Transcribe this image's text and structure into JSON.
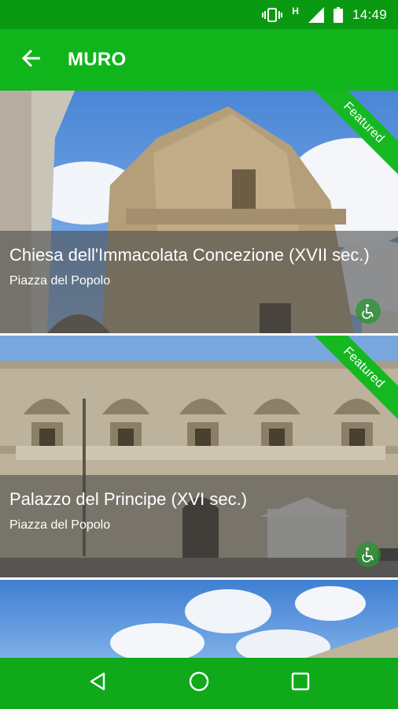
{
  "status_bar": {
    "time": "14:49",
    "network_label": "H",
    "icons": [
      "vibrate-icon",
      "signal-icon",
      "battery-icon"
    ]
  },
  "app_bar": {
    "title": "MURO",
    "back_icon": "arrow-back-icon"
  },
  "theme": {
    "primary": "#10b51c",
    "primary_dark": "#0a9a12",
    "nav": "#0fa91a"
  },
  "items": [
    {
      "title": "Chiesa dell'Immacolata Concezione (XVII sec.)",
      "subtitle": "Piazza del Popolo",
      "badge": "Featured",
      "accessible_icon": "wheelchair-icon"
    },
    {
      "title": "Palazzo del Principe (XVI sec.)",
      "subtitle": "Piazza del Popolo",
      "badge": "Featured",
      "accessible_icon": "wheelchair-icon"
    },
    {
      "title": "",
      "subtitle": "",
      "badge": ""
    }
  ],
  "nav_bar": {
    "buttons": [
      "back-triangle-icon",
      "home-circle-icon",
      "recents-square-icon"
    ]
  }
}
